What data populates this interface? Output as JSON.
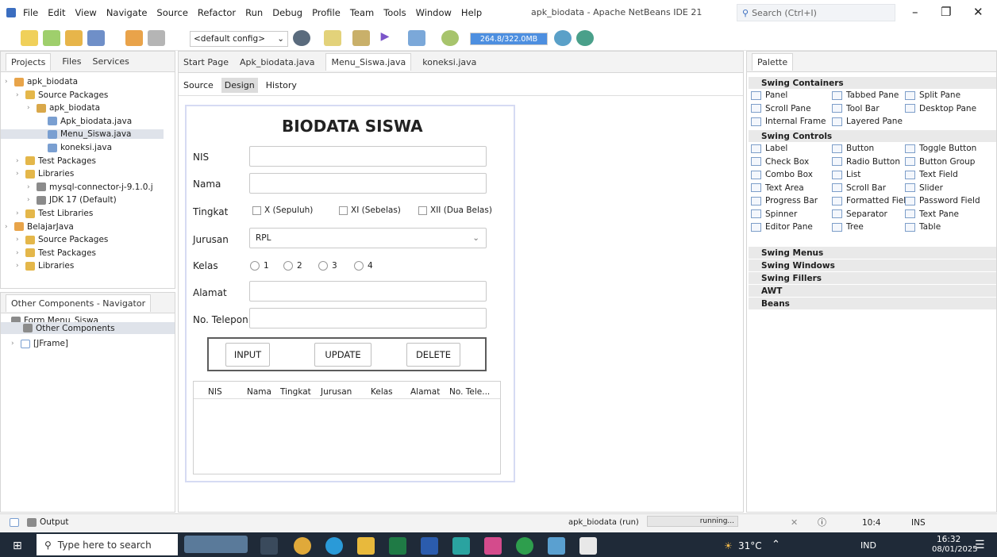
{
  "menubar": {
    "items": [
      "File",
      "Edit",
      "View",
      "Navigate",
      "Source",
      "Refactor",
      "Run",
      "Debug",
      "Profile",
      "Team",
      "Tools",
      "Window",
      "Help"
    ],
    "title": "apk_biodata - Apache NetBeans IDE 21",
    "search_placeholder": "Search (Ctrl+I)"
  },
  "toolbar": {
    "config": "<default config>",
    "memory": "264.8/322.0MB"
  },
  "projects": {
    "tabs": [
      "Projects",
      "Files",
      "Services"
    ],
    "tree": [
      {
        "label": "apk_biodata",
        "indent": 0,
        "kind": "project"
      },
      {
        "label": "Source Packages",
        "indent": 1,
        "kind": "folder"
      },
      {
        "label": "apk_biodata",
        "indent": 2,
        "kind": "package"
      },
      {
        "label": "Apk_biodata.java",
        "indent": 3,
        "kind": "java"
      },
      {
        "label": "Menu_Siswa.java",
        "indent": 3,
        "kind": "java",
        "selected": true
      },
      {
        "label": "koneksi.java",
        "indent": 3,
        "kind": "java"
      },
      {
        "label": "Test Packages",
        "indent": 1,
        "kind": "folder"
      },
      {
        "label": "Libraries",
        "indent": 1,
        "kind": "folder"
      },
      {
        "label": "mysql-connector-j-9.1.0.j",
        "indent": 2,
        "kind": "jar"
      },
      {
        "label": "JDK 17 (Default)",
        "indent": 2,
        "kind": "jar"
      },
      {
        "label": "Test Libraries",
        "indent": 1,
        "kind": "folder"
      },
      {
        "label": "BelajarJava",
        "indent": 0,
        "kind": "project"
      },
      {
        "label": "Source Packages",
        "indent": 1,
        "kind": "folder"
      },
      {
        "label": "Test Packages",
        "indent": 1,
        "kind": "folder"
      },
      {
        "label": "Libraries",
        "indent": 1,
        "kind": "folder"
      }
    ]
  },
  "navigator": {
    "title": "Other Components - Navigator",
    "items": [
      "Form Menu_Siswa",
      "Other Components",
      "[JFrame]"
    ]
  },
  "editor": {
    "tabs": [
      "Start Page",
      "Apk_biodata.java",
      "Menu_Siswa.java",
      "koneksi.java"
    ],
    "subtabs": [
      "Source",
      "Design",
      "History"
    ]
  },
  "form": {
    "title": "BIODATA SISWA",
    "labels": {
      "nis": "NIS",
      "nama": "Nama",
      "tingkat": "Tingkat",
      "jurusan": "Jurusan",
      "kelas": "Kelas",
      "alamat": "Alamat",
      "telepon": "No. Telepon"
    },
    "tingkat_options": [
      "X (Sepuluh)",
      "XI (Sebelas)",
      "XII (Dua Belas)"
    ],
    "jurusan_value": "RPL",
    "kelas_options": [
      "1",
      "2",
      "3",
      "4"
    ],
    "buttons": {
      "input": "INPUT",
      "update": "UPDATE",
      "delete": "DELETE"
    },
    "table_columns": [
      "NIS",
      "Nama",
      "Tingkat",
      "Jurusan",
      "Kelas",
      "Alamat",
      "No. Tele..."
    ]
  },
  "palette": {
    "title": "Palette",
    "sections": [
      "Swing Containers",
      "Swing Controls",
      "Swing Menus",
      "Swing Windows",
      "Swing Fillers",
      "AWT",
      "Beans"
    ],
    "containers": [
      "Panel",
      "Tabbed Pane",
      "Split Pane",
      "Scroll Pane",
      "Tool Bar",
      "Desktop Pane",
      "Internal Frame",
      "Layered Pane"
    ],
    "controls": [
      "Label",
      "Button",
      "Toggle Button",
      "Check Box",
      "Radio Button",
      "Button Group",
      "Combo Box",
      "List",
      "Text Field",
      "Text Area",
      "Scroll Bar",
      "Slider",
      "Progress Bar",
      "Formatted Field",
      "Password Field",
      "Spinner",
      "Separator",
      "Text Pane",
      "Editor Pane",
      "Tree",
      "Table"
    ]
  },
  "statusbar": {
    "output": "Output",
    "run": "apk_biodata (run)",
    "state": "running...",
    "position": "10:4",
    "mode": "INS"
  },
  "taskbar": {
    "search": "Type here to search",
    "temp": "31°C",
    "lang": "IND",
    "time": "16:32",
    "date": "08/01/2025"
  }
}
